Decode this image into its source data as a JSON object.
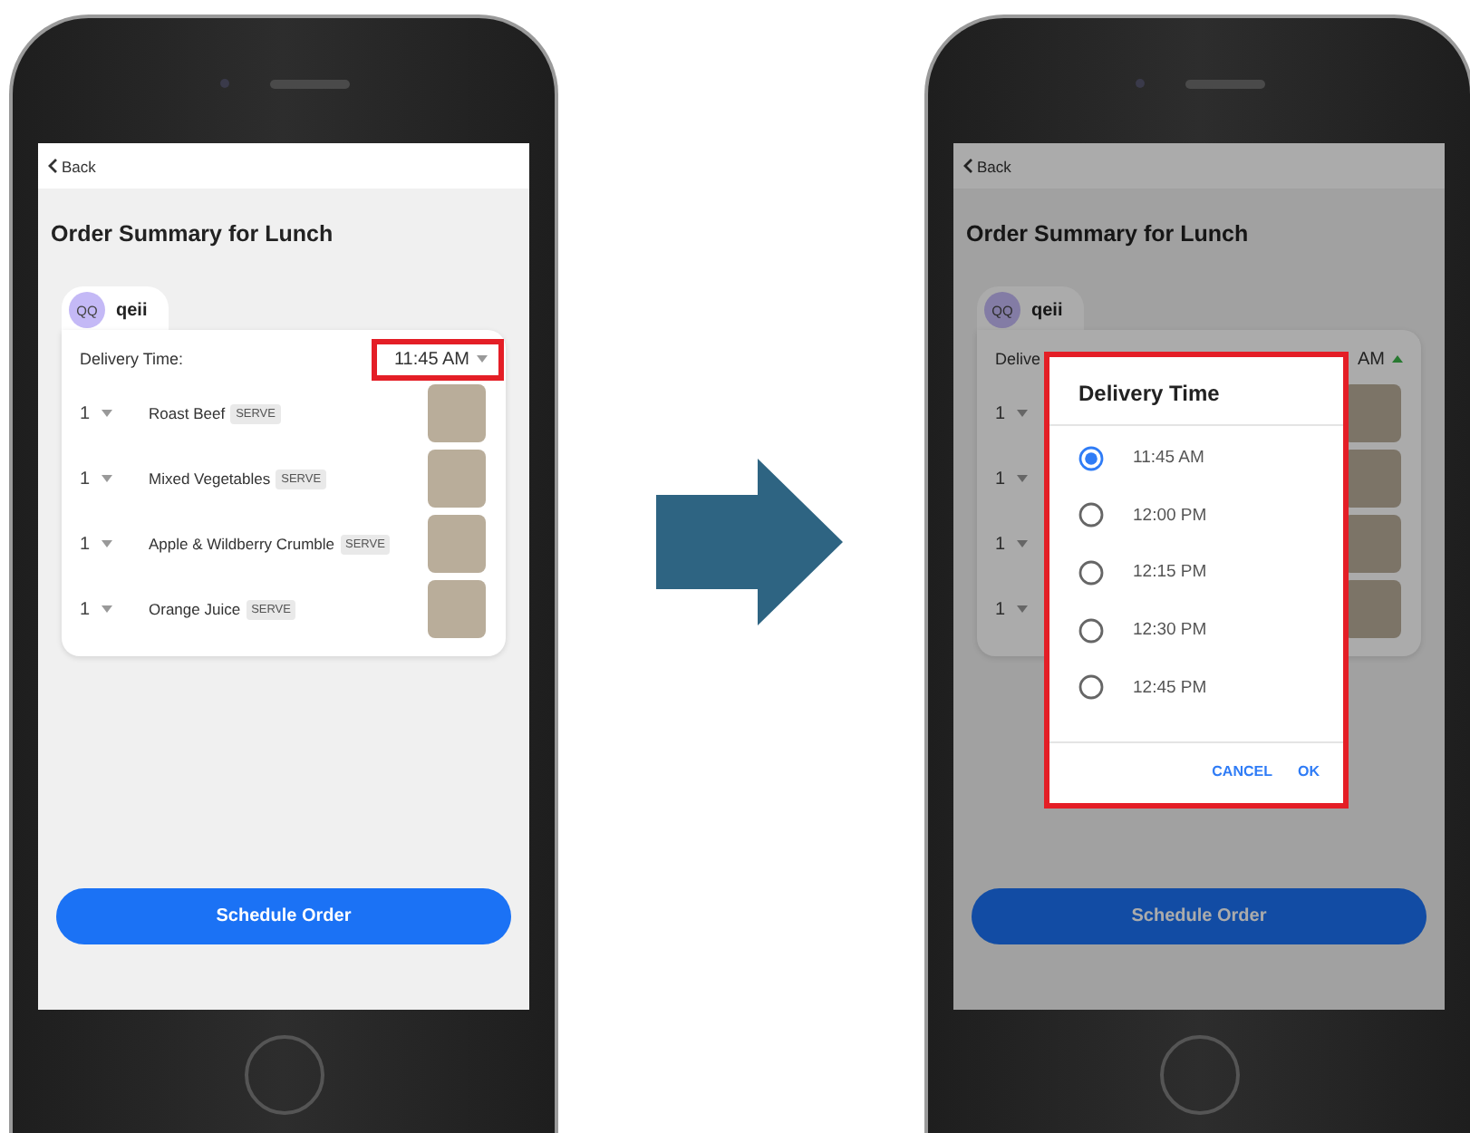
{
  "screens": [
    {
      "kind": "plain",
      "back": "Back",
      "title": "Order Summary for Lunch",
      "card": {
        "avatar": "QQ",
        "name": "qeii",
        "delivery_label": "Delivery Time:",
        "time_picker": {
          "value": "11:45 AM",
          "open": false,
          "highlighted": true
        },
        "items": [
          {
            "quantity": "1",
            "name": "Roast Beef",
            "tag": "SERVE"
          },
          {
            "quantity": "1",
            "name": "Mixed Vegetables",
            "tag": "SERVE"
          },
          {
            "quantity": "1",
            "name": "Apple & Wildberry Crumble",
            "tag": "SERVE"
          },
          {
            "quantity": "1",
            "name": "Orange Juice",
            "tag": "SERVE"
          }
        ]
      },
      "button": "Schedule Order"
    },
    {
      "kind": "dialog",
      "back": "Back",
      "title": "Order Summary for Lunch",
      "card": {
        "avatar": "QQ",
        "name": "qeii",
        "delivery_label": "Delive",
        "time_picker": {
          "value": "AM",
          "open": true,
          "highlighted": false
        },
        "items": [
          {
            "quantity": "1"
          },
          {
            "quantity": "1"
          },
          {
            "quantity": "1"
          },
          {
            "quantity": "1"
          }
        ]
      },
      "button": "Schedule Order",
      "dialog": {
        "title": "Delivery Time",
        "highlighted": true,
        "options": [
          {
            "label": "11:45 AM",
            "selected": true
          },
          {
            "label": "12:00 PM",
            "selected": false
          },
          {
            "label": "12:15 PM",
            "selected": false
          },
          {
            "label": "12:30 PM",
            "selected": false
          },
          {
            "label": "12:45 PM",
            "selected": false
          }
        ],
        "actions": [
          "CANCEL",
          "OK"
        ]
      }
    }
  ]
}
